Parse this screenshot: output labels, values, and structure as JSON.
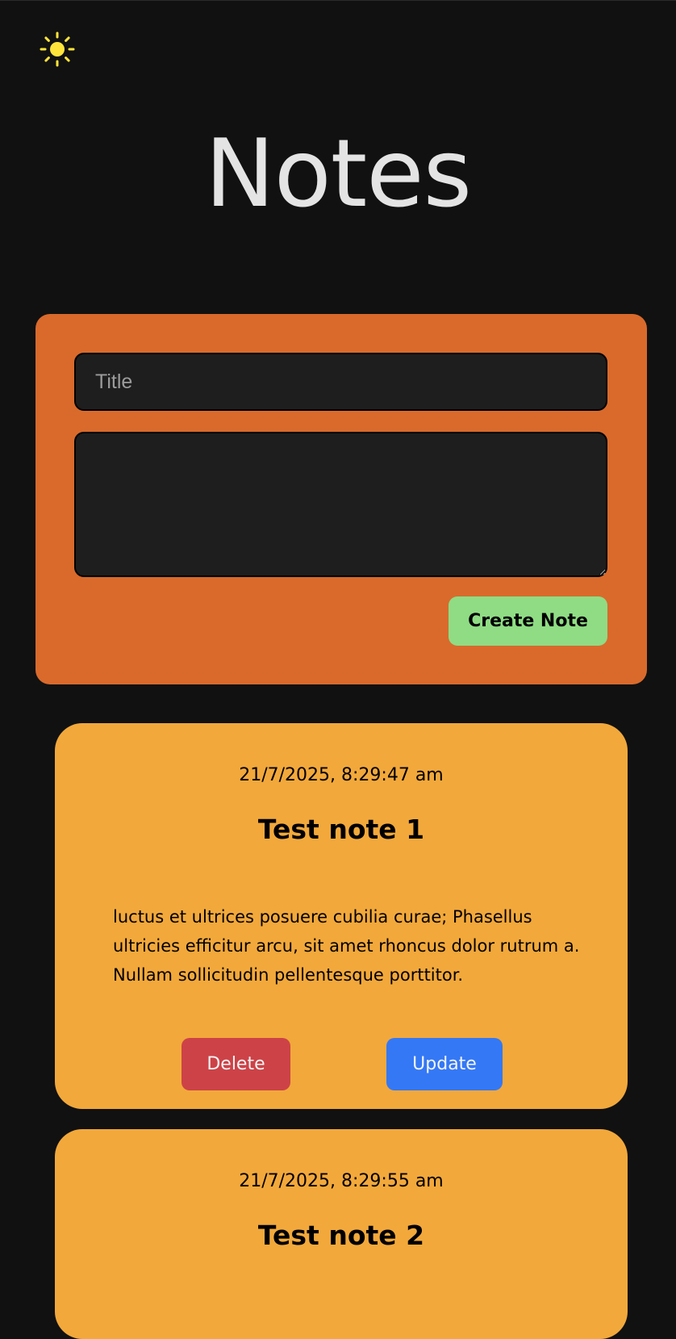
{
  "theme_toggle": {
    "icon": "sun-icon",
    "color": "#ffe53b"
  },
  "page": {
    "title": "Notes"
  },
  "create_form": {
    "title_placeholder": "Title",
    "title_value": "",
    "body_value": "",
    "create_label": "Create Note"
  },
  "notes": [
    {
      "date": "21/7/2025, 8:29:47 am",
      "title": "Test note 1",
      "body": "luctus et ultrices posuere cubilia curae; Phasellus ultricies efficitur arcu, sit amet rhoncus dolor rutrum a. Nullam sollicitudin pellentesque porttitor.",
      "delete_label": "Delete",
      "update_label": "Update"
    },
    {
      "date": "21/7/2025, 8:29:55 am",
      "title": "Test note 2"
    }
  ],
  "colors": {
    "background": "#111111",
    "form_background": "#d96a2c",
    "card_background": "#f2a83b",
    "create_button": "#8fdc84",
    "delete_button": "#cd4247",
    "update_button": "#3478f6"
  }
}
